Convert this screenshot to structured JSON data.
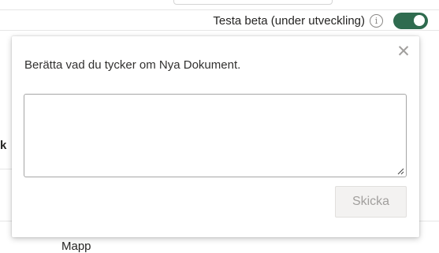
{
  "beta": {
    "label": "Testa beta (under utveckling)",
    "info_glyph": "i",
    "toggle_on": true,
    "toggle_color": "#2f6b4f"
  },
  "background": {
    "left_fragment": "k",
    "bottom_label": "Mapp"
  },
  "dialog": {
    "close_glyph": "✕",
    "prompt": "Berätta vad du tycker om Nya Dokument.",
    "input_value": "",
    "send_label": "Skicka",
    "send_disabled": true
  }
}
